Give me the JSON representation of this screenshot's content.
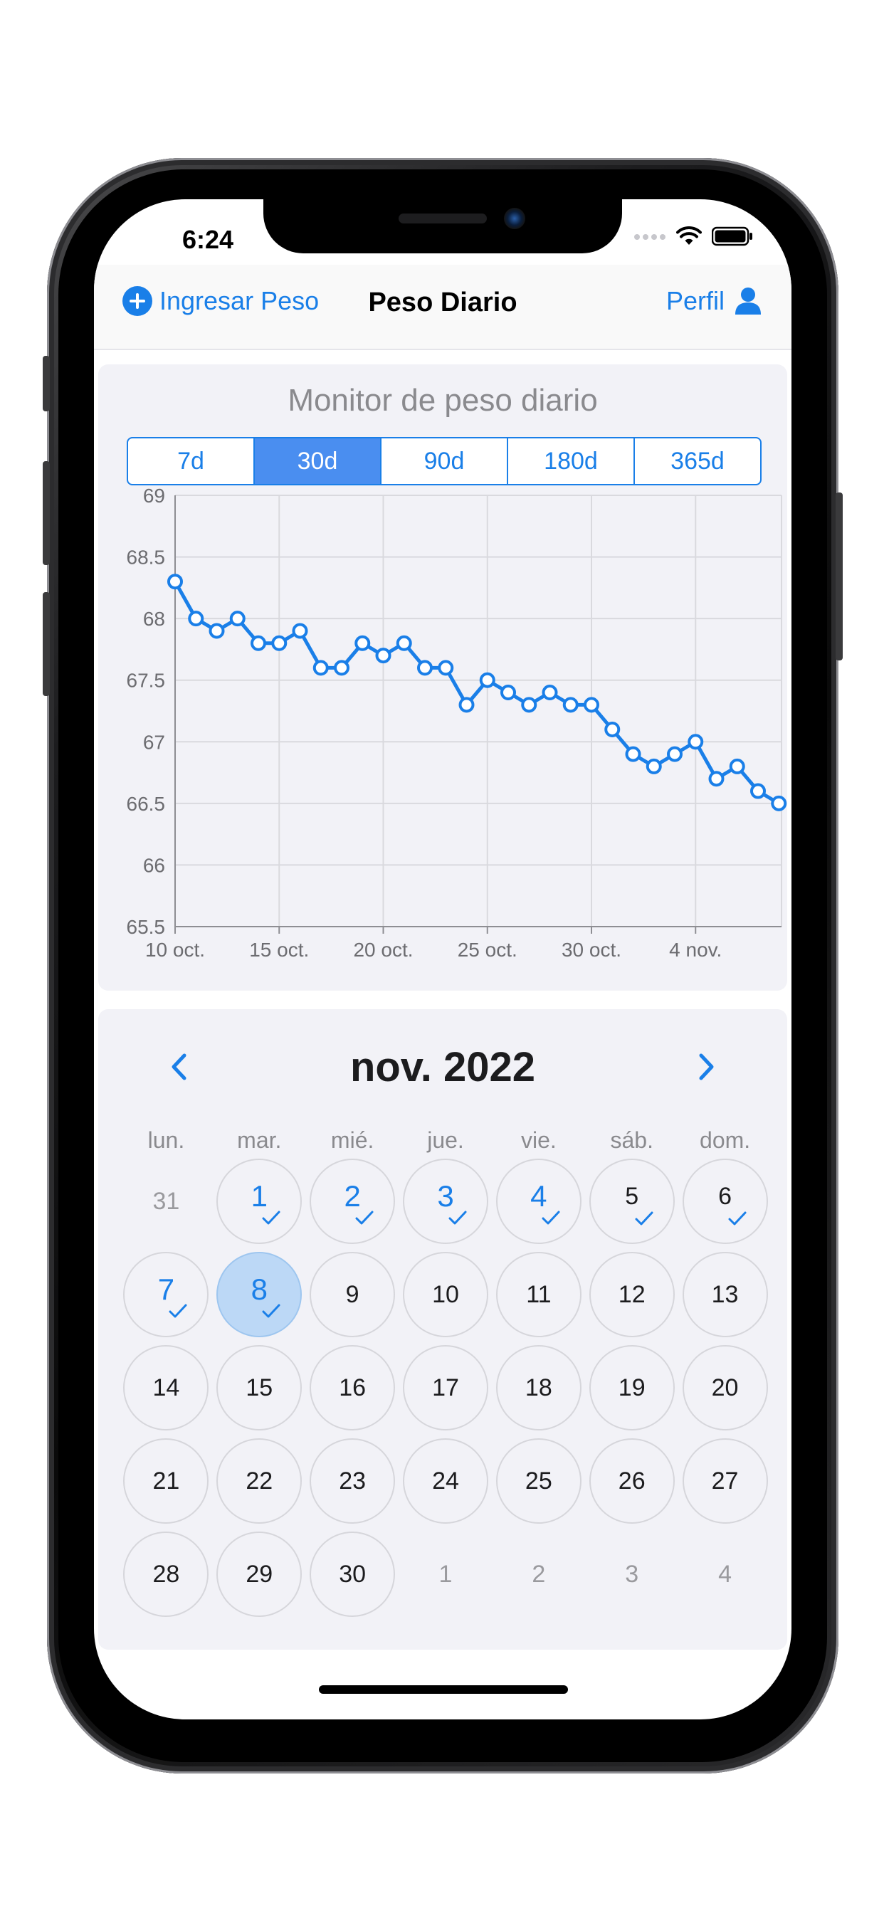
{
  "status_bar": {
    "time": "6:24"
  },
  "nav": {
    "left_label": "Ingresar Peso",
    "title": "Peso Diario",
    "right_label": "Perfil"
  },
  "chart": {
    "title": "Monitor de peso diario",
    "ranges": [
      "7d",
      "30d",
      "90d",
      "180d",
      "365d"
    ],
    "selected_range": "30d"
  },
  "chart_data": {
    "type": "line",
    "title": "Monitor de peso diario",
    "xlabel": "",
    "ylabel": "",
    "ylim": [
      65.5,
      69
    ],
    "yticks": [
      "69",
      "68.5",
      "68",
      "67.5",
      "67",
      "66.5",
      "66",
      "65.5"
    ],
    "xticks": [
      "10 oct.",
      "15 oct.",
      "20 oct.",
      "25 oct.",
      "30 oct.",
      "4 nov."
    ],
    "grid": true,
    "line_color": "#1a7fe8",
    "x": [
      "2022-10-10",
      "2022-10-11",
      "2022-10-12",
      "2022-10-13",
      "2022-10-14",
      "2022-10-15",
      "2022-10-16",
      "2022-10-17",
      "2022-10-18",
      "2022-10-19",
      "2022-10-20",
      "2022-10-21",
      "2022-10-22",
      "2022-10-23",
      "2022-10-24",
      "2022-10-25",
      "2022-10-26",
      "2022-10-27",
      "2022-10-28",
      "2022-10-29",
      "2022-10-30",
      "2022-10-31",
      "2022-11-01",
      "2022-11-02",
      "2022-11-03",
      "2022-11-04",
      "2022-11-05",
      "2022-11-06",
      "2022-11-07",
      "2022-11-08"
    ],
    "values": [
      68.3,
      68.0,
      67.9,
      68.0,
      67.8,
      67.8,
      67.9,
      67.6,
      67.6,
      67.8,
      67.7,
      67.8,
      67.6,
      67.6,
      67.3,
      67.5,
      67.4,
      67.3,
      67.4,
      67.3,
      67.3,
      67.1,
      66.9,
      66.8,
      66.9,
      67.0,
      66.7,
      66.8,
      66.6,
      66.5
    ]
  },
  "calendar": {
    "month_label": "nov. 2022",
    "weekdays": [
      "lun.",
      "mar.",
      "mié.",
      "jue.",
      "vie.",
      "sáb.",
      "dom."
    ],
    "days": [
      {
        "label": "31",
        "state": "other"
      },
      {
        "label": "1",
        "state": "logged"
      },
      {
        "label": "2",
        "state": "logged"
      },
      {
        "label": "3",
        "state": "logged"
      },
      {
        "label": "4",
        "state": "logged"
      },
      {
        "label": "5",
        "state": "done"
      },
      {
        "label": "6",
        "state": "done"
      },
      {
        "label": "7",
        "state": "logged"
      },
      {
        "label": "8",
        "state": "selected"
      },
      {
        "label": "9",
        "state": "normal"
      },
      {
        "label": "10",
        "state": "normal"
      },
      {
        "label": "11",
        "state": "normal"
      },
      {
        "label": "12",
        "state": "normal"
      },
      {
        "label": "13",
        "state": "normal"
      },
      {
        "label": "14",
        "state": "normal"
      },
      {
        "label": "15",
        "state": "normal"
      },
      {
        "label": "16",
        "state": "normal"
      },
      {
        "label": "17",
        "state": "normal"
      },
      {
        "label": "18",
        "state": "normal"
      },
      {
        "label": "19",
        "state": "normal"
      },
      {
        "label": "20",
        "state": "normal"
      },
      {
        "label": "21",
        "state": "normal"
      },
      {
        "label": "22",
        "state": "normal"
      },
      {
        "label": "23",
        "state": "normal"
      },
      {
        "label": "24",
        "state": "normal"
      },
      {
        "label": "25",
        "state": "normal"
      },
      {
        "label": "26",
        "state": "normal"
      },
      {
        "label": "27",
        "state": "normal"
      },
      {
        "label": "28",
        "state": "normal"
      },
      {
        "label": "29",
        "state": "normal"
      },
      {
        "label": "30",
        "state": "normal"
      },
      {
        "label": "1",
        "state": "other"
      },
      {
        "label": "2",
        "state": "other"
      },
      {
        "label": "3",
        "state": "other"
      },
      {
        "label": "4",
        "state": "other"
      }
    ]
  },
  "colors": {
    "accent": "#1a7fe8",
    "segment_active": "#4a8ef0",
    "card_bg": "#f2f2f7",
    "selected_day": "#bcd8f6"
  },
  "icons": {
    "add": "plus-circle-icon",
    "profile": "person-icon",
    "prev": "chevron-left-icon",
    "next": "chevron-right-icon",
    "check": "checkmark-icon"
  }
}
